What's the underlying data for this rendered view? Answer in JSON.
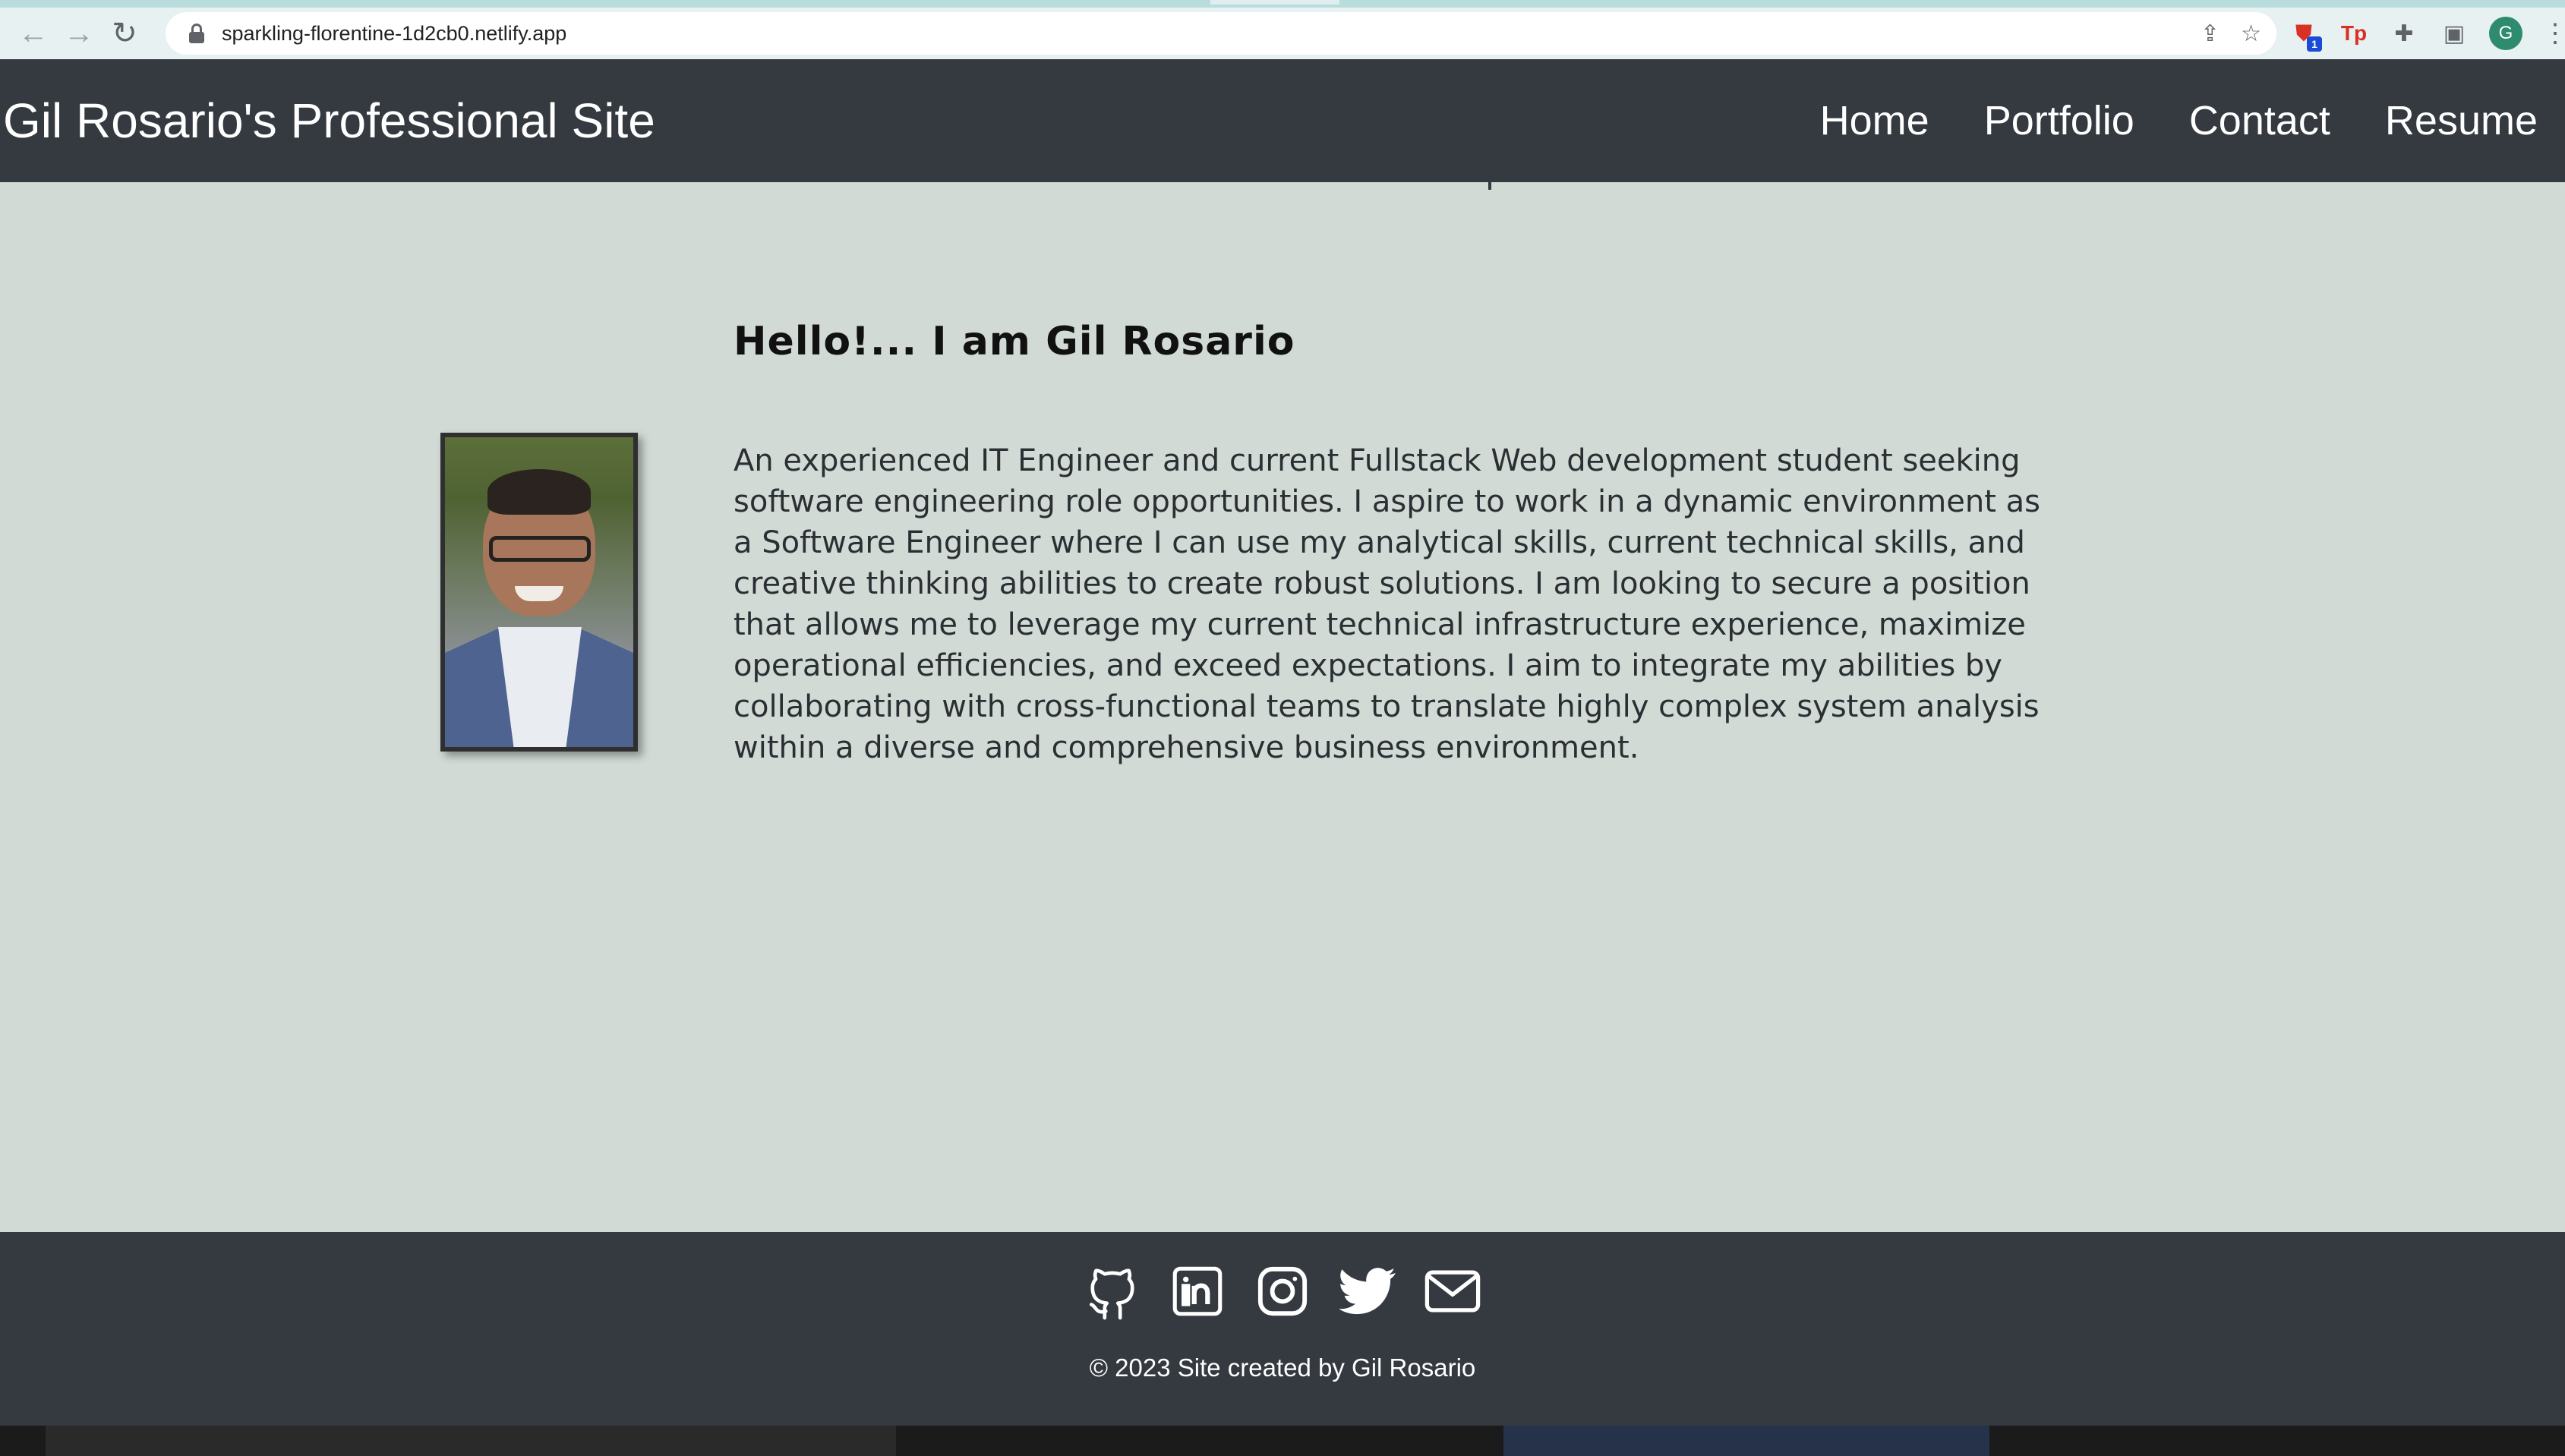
{
  "browser": {
    "url": "sparkling-florentine-1d2cb0.netlify.app",
    "profile_initial": "G",
    "extension_badge": "1",
    "extension_tp_label": "Tp"
  },
  "header": {
    "title": "Gil Rosario's Professional Site",
    "nav": [
      "Home",
      "Portfolio",
      "Contact",
      "Resume"
    ]
  },
  "about": {
    "greeting": "Hello!... I am Gil Rosario",
    "bio": "An experienced IT Engineer and current Fullstack Web development student seeking software engineering role opportunities. I aspire to work in a dynamic environment as a Software Engineer where I can use my analytical skills, current technical skills, and creative thinking abilities to create robust solutions. I am looking to secure a position that allows me to leverage my current technical infrastructure experience, maximize operational efficiencies, and exceed expectations. I aim to integrate my abilities by collaborating with cross-functional teams to translate highly complex system analysis within a diverse and comprehensive business environment."
  },
  "footer": {
    "social_icons": [
      "github-icon",
      "linkedin-icon",
      "instagram-icon",
      "twitter-icon",
      "mail-icon"
    ],
    "copyright": "© 2023 Site created by Gil Rosario"
  },
  "colors": {
    "header_bg": "#343a40",
    "page_bg": "#d1dad5",
    "footer_bg": "#343a40"
  }
}
